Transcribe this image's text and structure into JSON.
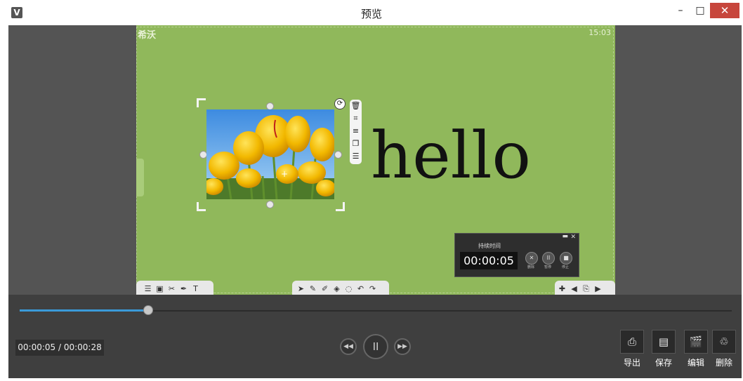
{
  "window": {
    "title": "预览",
    "app_icon": "V",
    "minimize_glyph": "–",
    "maximize_glyph": "□",
    "close_glyph": "✕"
  },
  "slide": {
    "logo": "希沃",
    "clock": "15:03",
    "text": "hello",
    "background": "#90b85b"
  },
  "timer": {
    "label": "持续时间",
    "value": "00:00:05",
    "buttons": [
      {
        "icon": "close-icon",
        "caption": "删除"
      },
      {
        "icon": "pause-icon",
        "caption": "暂停"
      },
      {
        "icon": "stop-icon",
        "caption": "停止"
      }
    ]
  },
  "playback": {
    "time": "00:00:05 / 00:00:28",
    "progress": 0.18,
    "accent": "#3a9ad9"
  },
  "actions": [
    {
      "label": "导出",
      "icon": "export-icon"
    },
    {
      "label": "保存",
      "icon": "save-icon"
    },
    {
      "label": "编辑",
      "icon": "edit-icon"
    },
    {
      "label": "删除",
      "icon": "delete-icon"
    }
  ]
}
